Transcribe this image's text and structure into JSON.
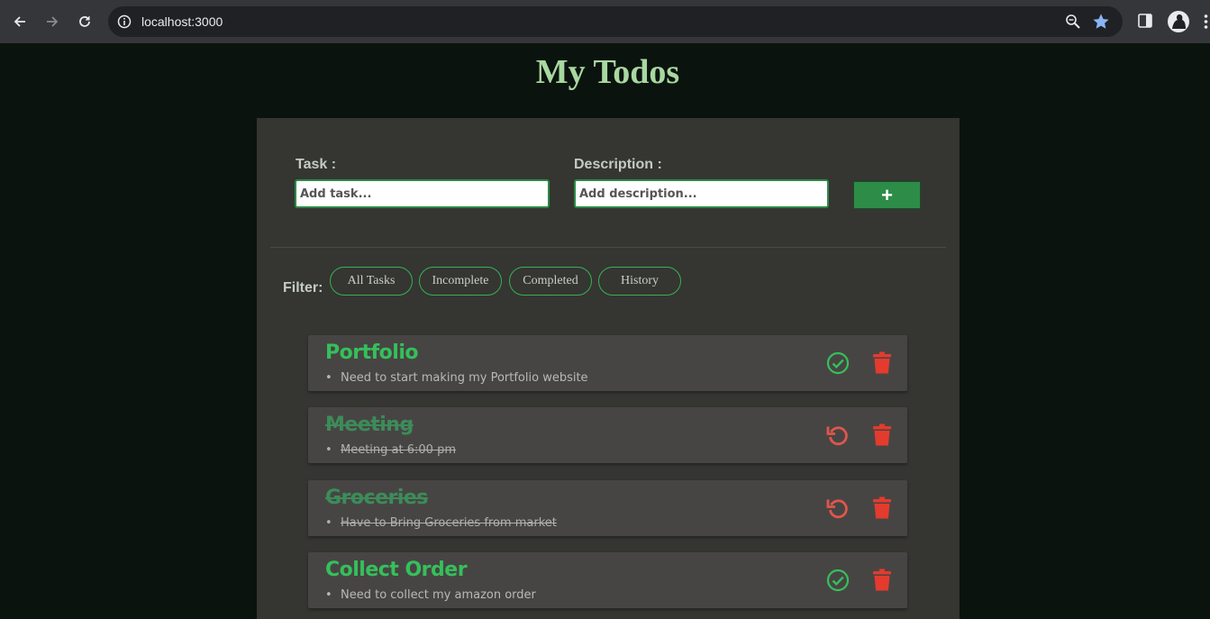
{
  "browser": {
    "url": "localhost:3000"
  },
  "page": {
    "title": "My Todos"
  },
  "form": {
    "task_label": "Task :",
    "task_placeholder": "Add task...",
    "description_label": "Description :",
    "description_placeholder": "Add description...",
    "add_button_label": "+"
  },
  "filter": {
    "label": "Filter:",
    "options": [
      "All Tasks",
      "Incomplete",
      "Completed",
      "History"
    ]
  },
  "todos": [
    {
      "title": "Portfolio",
      "description": "Need to start making my Portfolio website",
      "completed": false,
      "action_icon": "check-circle-icon"
    },
    {
      "title": "Meeting",
      "description": "Meeting at 6:00 pm",
      "completed": true,
      "action_icon": "undo-icon"
    },
    {
      "title": "Groceries",
      "description": "Have to Bring Groceries from market",
      "completed": true,
      "action_icon": "undo-icon"
    },
    {
      "title": "Collect Order",
      "description": "Need to collect my amazon order",
      "completed": false,
      "action_icon": "check-circle-icon"
    }
  ],
  "colors": {
    "background": "#0b130e",
    "panel": "#353532",
    "accent_green": "#35c05a",
    "delete_red": "#e33b2e",
    "undo_red": "#e0564a"
  }
}
